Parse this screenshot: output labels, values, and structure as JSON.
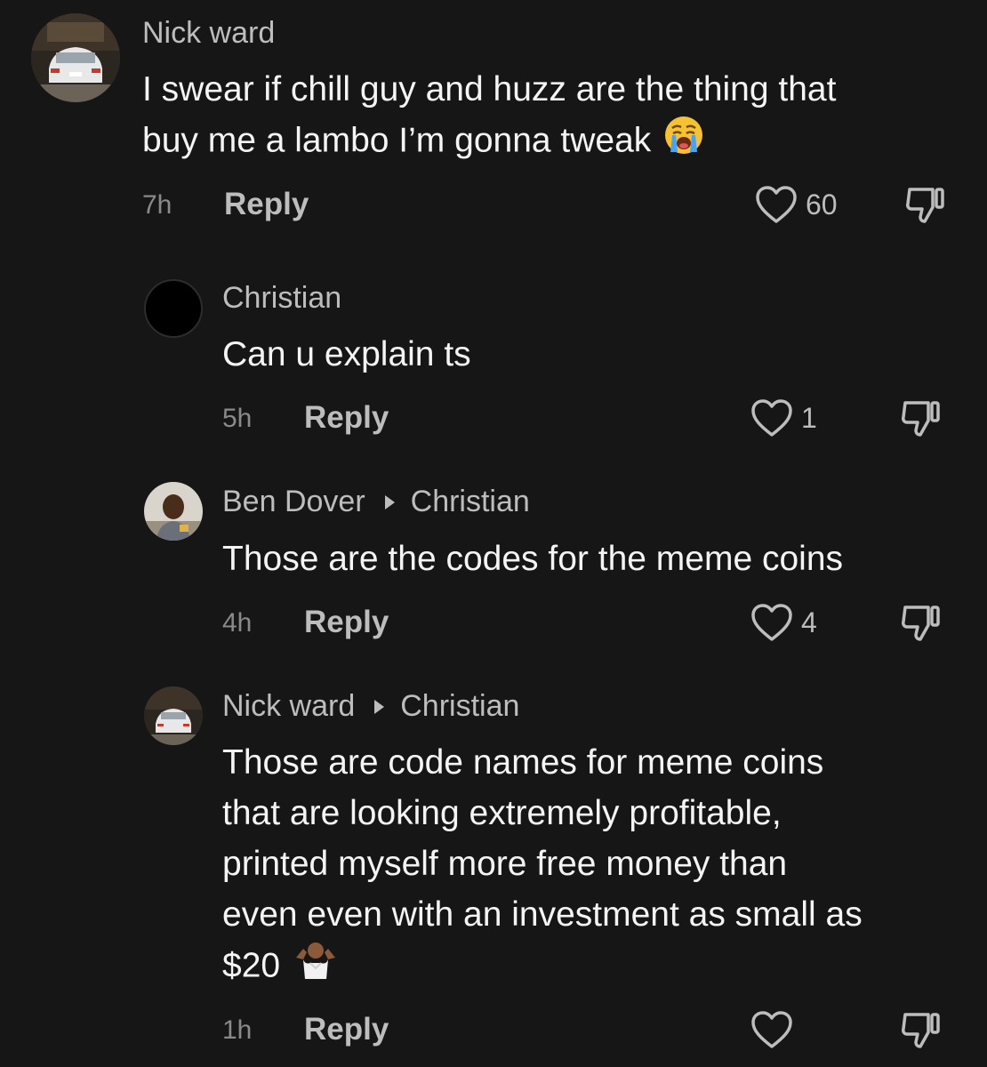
{
  "comments": [
    {
      "username": "Nick ward",
      "text_lines": [
        "I swear if chill guy and huzz are the thing that",
        "buy me a lambo I’m gonna tweak"
      ],
      "emoji": "loudly-crying-face-emoji",
      "time": "7h",
      "reply_label": "Reply",
      "likes": "60"
    },
    {
      "username": "Christian",
      "text_lines": [
        "Can u explain ts"
      ],
      "time": "5h",
      "reply_label": "Reply",
      "likes": "1"
    },
    {
      "username": "Ben Dover",
      "reply_to": "Christian",
      "text_lines": [
        "Those are the codes for the meme coins"
      ],
      "time": "4h",
      "reply_label": "Reply",
      "likes": "4"
    },
    {
      "username": "Nick ward",
      "reply_to": "Christian",
      "text_lines": [
        "Those are code names for meme coins",
        "that are looking extremely profitable,",
        "printed myself more free money than",
        "even even with an investment as small as",
        "$20"
      ],
      "emoji": "shrug-emoji",
      "time": "1h",
      "reply_label": "Reply",
      "likes": ""
    }
  ],
  "colors": {
    "background": "#161616",
    "primary_text": "#f4f4f4",
    "secondary_text": "#bdbdbd",
    "muted_text": "#8a8a8a"
  },
  "icons": {
    "like": "heart-outline-icon",
    "dislike": "thumbs-down-outline-icon",
    "reply_arrow": "triangle-right-icon"
  }
}
